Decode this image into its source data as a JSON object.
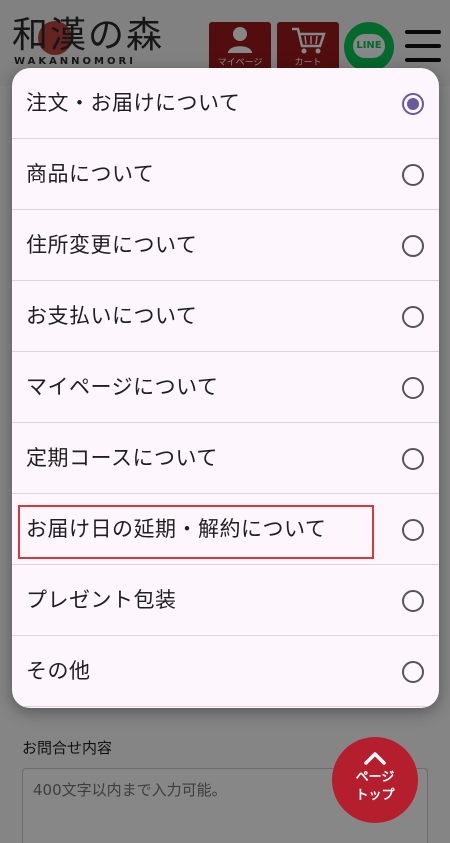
{
  "header": {
    "logo_text": "和漢の森",
    "logo_sub": "WAKANNOMORI",
    "mypage_label": "マイページ",
    "cart_label": "カート",
    "line_label": "LINE"
  },
  "form": {
    "inquiry_label": "お問合せ内容",
    "inquiry_placeholder": "400文字以内まで入力可能。"
  },
  "page_top": {
    "line1": "ページ",
    "line2": "トップ"
  },
  "dropdown": {
    "selected_index": 0,
    "highlighted_index": 6,
    "options": [
      {
        "label": "注文・お届けについて"
      },
      {
        "label": "商品について"
      },
      {
        "label": "住所変更について"
      },
      {
        "label": "お支払いについて"
      },
      {
        "label": "マイページについて"
      },
      {
        "label": "定期コースについて"
      },
      {
        "label": "お届け日の延期・解約について"
      },
      {
        "label": "プレゼント包装"
      },
      {
        "label": "その他"
      }
    ]
  },
  "colors": {
    "brand_red": "#9b1c1c",
    "line_green": "#06c755",
    "radio_selected": "#6a5a9a",
    "highlight": "#d9363e"
  }
}
